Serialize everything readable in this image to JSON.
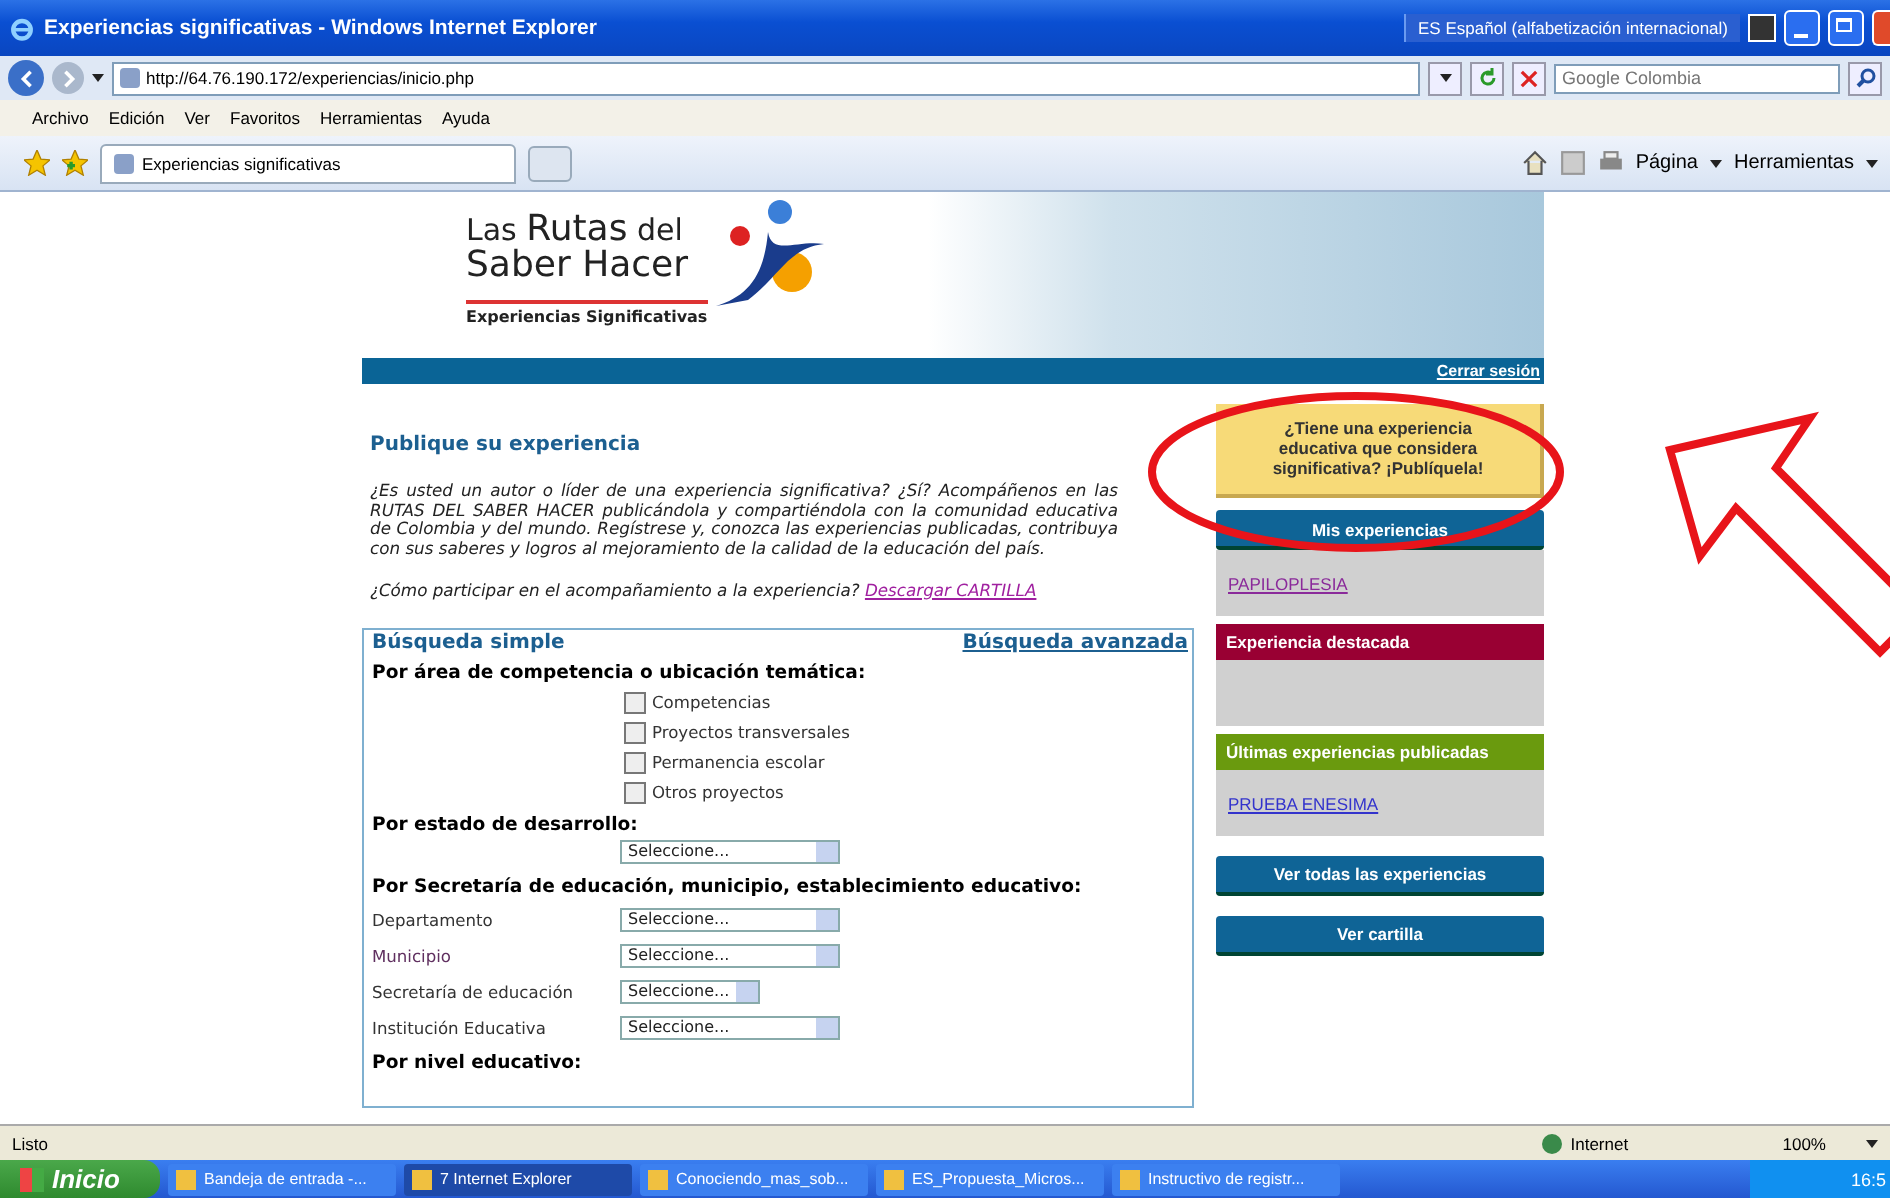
{
  "window": {
    "title": "Experiencias significativas - Windows Internet Explorer",
    "language_bar": "ES Español (alfabetización internacional)"
  },
  "address_bar": {
    "url": "http://64.76.190.172/experiencias/inicio.php",
    "search_placeholder": "Google Colombia"
  },
  "menu": [
    "Archivo",
    "Edición",
    "Ver",
    "Favoritos",
    "Herramientas",
    "Ayuda"
  ],
  "tabs": [
    {
      "label": "Experiencias significativas",
      "selected": true
    }
  ],
  "command_bar": [
    "Página",
    "Herramientas"
  ],
  "page": {
    "logo": {
      "line1a": "Las",
      "line1b": "Rutas",
      "line1c": "del",
      "line2": "Saber Hacer",
      "tagline": "Experiencias Significativas"
    },
    "header_link": "Cerrar sesión",
    "title": "Publique su experiencia",
    "intro": "¿Es usted un autor o líder de una experiencia significativa? ¿Sí? Acompáñenos en las RUTAS DEL SABER HACER publicándola y compartiéndola con la comunidad educativa de Colombia y del mundo. Regístrese y, conozca las experiencias publicadas, contribuya con sus saberes y logros al mejoramiento de la calidad de la educación del país.",
    "question": "¿Cómo participar en el acompañamiento a la experiencia?",
    "download_link": "Descargar CARTILLA",
    "search": {
      "title": "Búsqueda simple",
      "advanced_link": "Búsqueda avanzada",
      "area_heading": "Por área de competencia o ubicación temática:",
      "areas": [
        {
          "label": "Competencias",
          "checked": false
        },
        {
          "label": "Proyectos transversales",
          "checked": false
        },
        {
          "label": "Permanencia escolar",
          "checked": false
        },
        {
          "label": "Otros proyectos",
          "checked": false
        }
      ],
      "state_heading": "Por estado de desarrollo:",
      "state_select": "Seleccione...",
      "location_heading": "Por Secretaría de educación, municipio, establecimiento educativo:",
      "location_fields": [
        {
          "label": "Departamento",
          "value": "Seleccione..."
        },
        {
          "label": "Municipio",
          "value": "Seleccione..."
        },
        {
          "label": "Secretaría de educación",
          "value": "Seleccione..."
        },
        {
          "label": "Institución Educativa",
          "value": "Seleccione..."
        }
      ],
      "level_heading": "Por nivel educativo:"
    },
    "sidebar": {
      "publish_box": "¿Tiene una experiencia educativa que considera significativa? ¡Publíquela!",
      "panels": [
        {
          "title": "Mis experiencias",
          "kind": "button",
          "color": "#0f6496",
          "link": "PAPILOPLESIA"
        },
        {
          "title": "Experiencia destacada",
          "kind": "header",
          "color": "#990033"
        },
        {
          "title": "Últimas experiencias publicadas",
          "kind": "header",
          "color": "#6a9a0e",
          "link": "PRUEBA ENESIMA"
        }
      ],
      "buttons": [
        "Ver todas las experiencias",
        "Ver cartilla"
      ]
    }
  },
  "status_bar": {
    "text": "Listo",
    "zone": "Internet",
    "zoom": "100%"
  },
  "taskbar": {
    "start": "Inicio",
    "items": [
      {
        "label": "Bandeja de entrada -...",
        "selected": false
      },
      {
        "label": "7 Internet Explorer",
        "selected": true
      },
      {
        "label": "Conociendo_mas_sob...",
        "selected": false
      },
      {
        "label": "ES_Propuesta_Micros...",
        "selected": false
      },
      {
        "label": "Instructivo de registr...",
        "selected": false
      }
    ],
    "clock": "16:5"
  }
}
